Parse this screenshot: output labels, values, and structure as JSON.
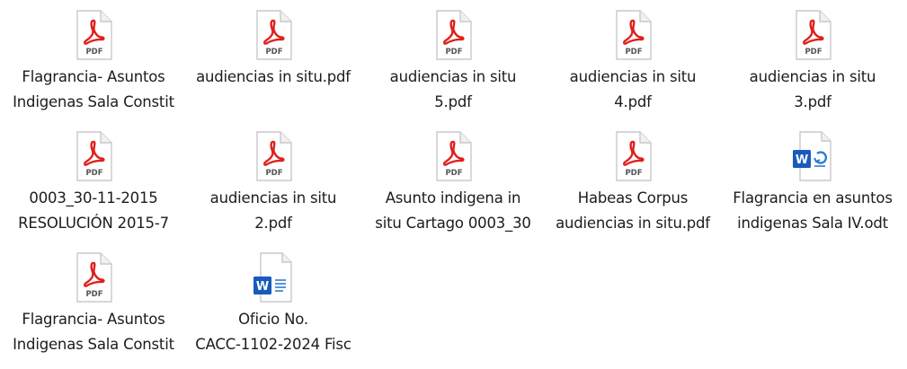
{
  "files": [
    {
      "name": "Flagrancia- Asuntos\nIndigenas Sala Constit",
      "type": "pdf",
      "icon": "pdf-file-icon"
    },
    {
      "name": "audiencias in situ.pdf",
      "type": "pdf",
      "icon": "pdf-file-icon"
    },
    {
      "name": "audiencias in situ\n5.pdf",
      "type": "pdf",
      "icon": "pdf-file-icon"
    },
    {
      "name": "audiencias in situ\n4.pdf",
      "type": "pdf",
      "icon": "pdf-file-icon"
    },
    {
      "name": "audiencias in situ\n3.pdf",
      "type": "pdf",
      "icon": "pdf-file-icon"
    },
    {
      "name": "0003_30-11-2015\nRESOLUCIÓN 2015-7",
      "type": "pdf",
      "icon": "pdf-file-icon"
    },
    {
      "name": "audiencias in situ\n2.pdf",
      "type": "pdf",
      "icon": "pdf-file-icon"
    },
    {
      "name": "Asunto indigena in\nsitu Cartago 0003_30",
      "type": "pdf",
      "icon": "pdf-file-icon"
    },
    {
      "name": "Habeas Corpus\naudiencias in situ.pdf",
      "type": "pdf",
      "icon": "pdf-file-icon"
    },
    {
      "name": "Flagrancia en asuntos\nindigenas Sala IV.odt",
      "type": "odt",
      "icon": "word-odt-file-icon"
    },
    {
      "name": "Flagrancia- Asuntos\nIndigenas Sala Constit",
      "type": "pdf",
      "icon": "pdf-file-icon"
    },
    {
      "name": "Oficio No.\nCACC-1102-2024 Fisc",
      "type": "docx",
      "icon": "word-docx-file-icon"
    }
  ],
  "colors": {
    "pdf_red": "#e0201b",
    "word_blue": "#185abd",
    "page_border": "#c8c8c8",
    "text": "#1c1c1c"
  }
}
